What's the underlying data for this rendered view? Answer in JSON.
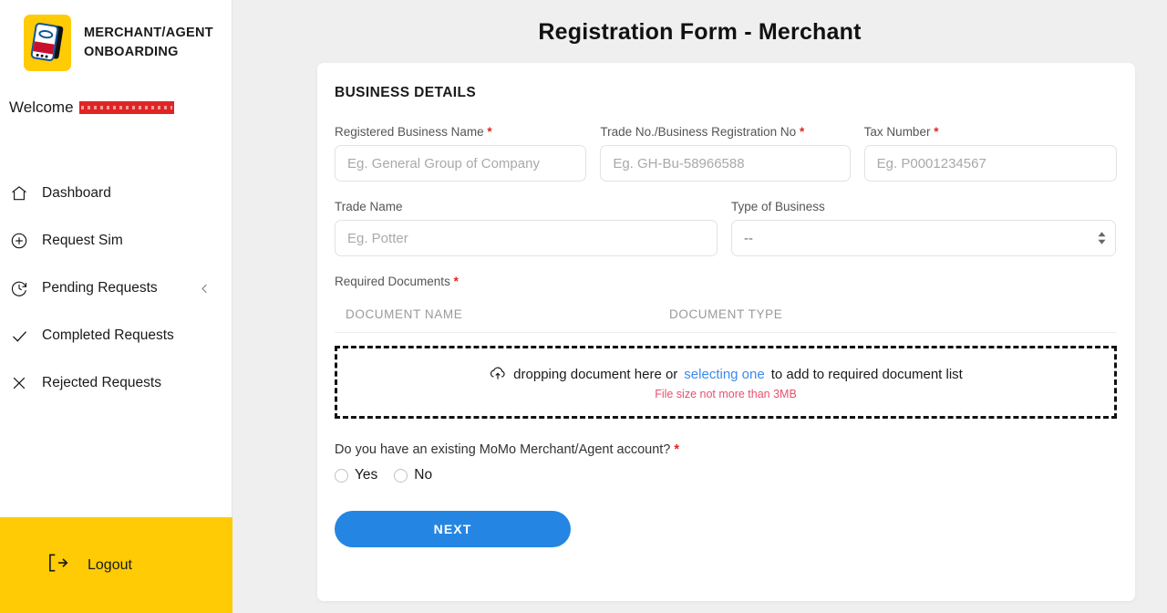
{
  "sidebar": {
    "brand_title": "MERCHANT/AGENT ONBOARDING",
    "logo_icon": "momo-phone-logo",
    "welcome_label": "Welcome",
    "welcome_value_redacted": "",
    "items": [
      {
        "label": "Dashboard",
        "icon": "home-icon",
        "chevron": false
      },
      {
        "label": "Request Sim",
        "icon": "plus-circle-icon",
        "chevron": false
      },
      {
        "label": "Pending Requests",
        "icon": "clock-icon",
        "chevron": true
      },
      {
        "label": "Completed Requests",
        "icon": "check-icon",
        "chevron": false
      },
      {
        "label": "Rejected Requests",
        "icon": "close-x-icon",
        "chevron": false
      }
    ],
    "logout_label": "Logout",
    "logout_icon": "logout-arrow-icon"
  },
  "main": {
    "page_title": "Registration Form - Merchant",
    "section_title": "BUSINESS DETAILS",
    "required_marker": "*",
    "fields": {
      "registered_business_name": {
        "label": "Registered Business Name",
        "required": true,
        "placeholder": "Eg. General Group of Company",
        "value": ""
      },
      "trade_no": {
        "label": "Trade No./Business Registration No",
        "required": true,
        "placeholder": "Eg. GH-Bu-58966588",
        "value": ""
      },
      "tax_number": {
        "label": "Tax Number",
        "required": true,
        "placeholder": "Eg. P0001234567",
        "value": ""
      },
      "trade_name": {
        "label": "Trade Name",
        "required": false,
        "placeholder": "Eg. Potter",
        "value": ""
      },
      "type_of_business": {
        "label": "Type of Business",
        "required": false,
        "selected": "--",
        "options": [
          "--"
        ]
      }
    },
    "documents": {
      "label": "Required Documents",
      "required": true,
      "columns": [
        "DOCUMENT NAME",
        "DOCUMENT TYPE"
      ],
      "rows": [],
      "dropzone": {
        "icon": "cloud-upload-icon",
        "text_before": "dropping document here or",
        "link_text": "selecting one",
        "text_after": "to add to required document list",
        "note": "File size not more than 3MB"
      }
    },
    "existing_account": {
      "question": "Do you have an existing MoMo Merchant/Agent account?",
      "required": true,
      "options": [
        "Yes",
        "No"
      ],
      "selected": ""
    },
    "next_button": "NEXT"
  },
  "colors": {
    "brand_yellow": "#ffcb05",
    "accent_blue": "#2486e2",
    "link_blue": "#3b8beb",
    "required_red": "#e02424",
    "note_pink": "#e8506e",
    "page_bg": "#efefef"
  }
}
